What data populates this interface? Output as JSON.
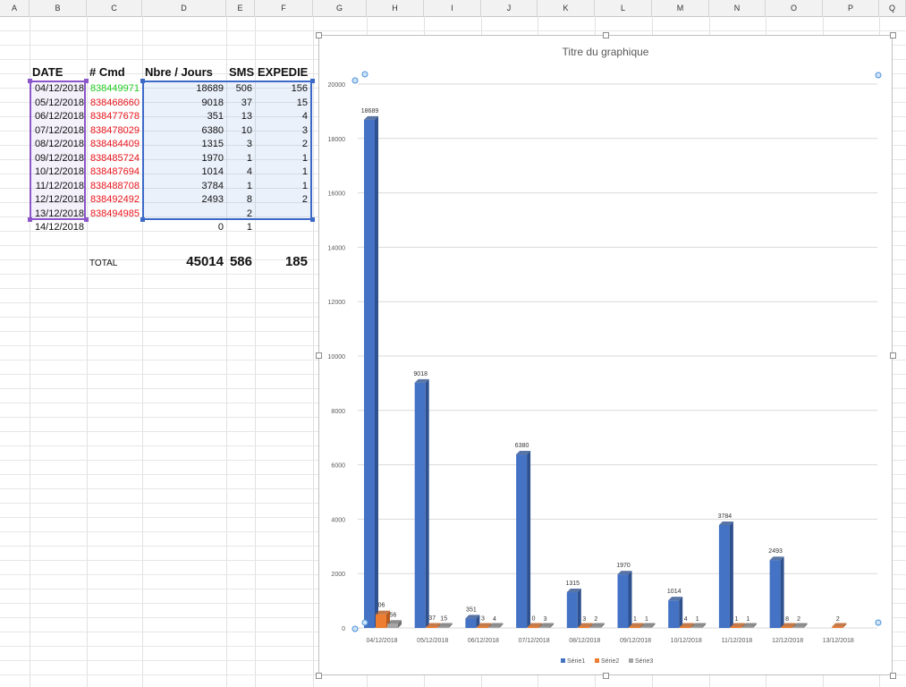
{
  "columns": [
    "A",
    "B",
    "C",
    "D",
    "E",
    "F",
    "G",
    "H",
    "I",
    "J",
    "K",
    "L",
    "M",
    "N",
    "O",
    "P",
    "Q"
  ],
  "table": {
    "headers": {
      "date": "DATE",
      "cmd": "# Cmd",
      "nbre": "Nbre / Jours",
      "sms": "SMS",
      "expedie": "EXPEDIE"
    },
    "rows": [
      {
        "date": "04/12/2018",
        "cmd": "838449971",
        "cmd_color": "green",
        "nbre": "18689",
        "sms": "506",
        "expedie": "156"
      },
      {
        "date": "05/12/2018",
        "cmd": "838468660",
        "cmd_color": "red",
        "nbre": "9018",
        "sms": "37",
        "expedie": "15"
      },
      {
        "date": "06/12/2018",
        "cmd": "838477678",
        "cmd_color": "red",
        "nbre": "351",
        "sms": "13",
        "expedie": "4"
      },
      {
        "date": "07/12/2018",
        "cmd": "838478029",
        "cmd_color": "red",
        "nbre": "6380",
        "sms": "10",
        "expedie": "3"
      },
      {
        "date": "08/12/2018",
        "cmd": "838484409",
        "cmd_color": "red",
        "nbre": "1315",
        "sms": "3",
        "expedie": "2"
      },
      {
        "date": "09/12/2018",
        "cmd": "838485724",
        "cmd_color": "red",
        "nbre": "1970",
        "sms": "1",
        "expedie": "1"
      },
      {
        "date": "10/12/2018",
        "cmd": "838487694",
        "cmd_color": "red",
        "nbre": "1014",
        "sms": "4",
        "expedie": "1"
      },
      {
        "date": "11/12/2018",
        "cmd": "838488708",
        "cmd_color": "red",
        "nbre": "3784",
        "sms": "1",
        "expedie": "1"
      },
      {
        "date": "12/12/2018",
        "cmd": "838492492",
        "cmd_color": "red",
        "nbre": "2493",
        "sms": "8",
        "expedie": "2"
      },
      {
        "date": "13/12/2018",
        "cmd": "838494985",
        "cmd_color": "red",
        "nbre": "",
        "sms": "2",
        "expedie": ""
      },
      {
        "date": "14/12/2018",
        "cmd": "",
        "cmd_color": "red",
        "nbre": "0",
        "sms": "1",
        "expedie": ""
      }
    ],
    "total": {
      "label": "TOTAL",
      "nbre": "45014",
      "sms": "586",
      "expedie": "185"
    }
  },
  "colors": {
    "red": "#e8141c",
    "green": "#22cc22",
    "serie1": "#4472c4",
    "serie2": "#ed7d31",
    "serie3": "#a5a5a5"
  },
  "chart_data": {
    "type": "bar",
    "title": "Titre du graphique",
    "categories": [
      "04/12/2018",
      "05/12/2018",
      "06/12/2018",
      "07/12/2018",
      "08/12/2018",
      "09/12/2018",
      "10/12/2018",
      "11/12/2018",
      "12/12/2018",
      "13/12/2018"
    ],
    "series": [
      {
        "name": "Série1",
        "values": [
          18689,
          9018,
          351,
          6380,
          1315,
          1970,
          1014,
          3784,
          2493,
          null
        ],
        "labels": [
          "18689",
          "9018",
          "351",
          "6380",
          "1315",
          "1970",
          "1014",
          "3784",
          "2493",
          ""
        ]
      },
      {
        "name": "Série2",
        "values": [
          506,
          37,
          13,
          10,
          3,
          1,
          4,
          1,
          8,
          2
        ],
        "labels": [
          "06",
          "37",
          "3",
          "0",
          "3",
          "1",
          "4",
          "1",
          "8",
          "2"
        ]
      },
      {
        "name": "Série3",
        "values": [
          156,
          15,
          4,
          3,
          2,
          1,
          1,
          1,
          2,
          null
        ],
        "labels": [
          "56",
          "15",
          "4",
          "3",
          "2",
          "1",
          "1",
          "1",
          "2",
          ""
        ]
      }
    ],
    "yticks": [
      "0",
      "2000",
      "4000",
      "6000",
      "8000",
      "10000",
      "12000",
      "14000",
      "16000",
      "18000",
      "20000"
    ],
    "ylim": [
      0,
      20000
    ],
    "grid": true,
    "legend": "bottom"
  }
}
